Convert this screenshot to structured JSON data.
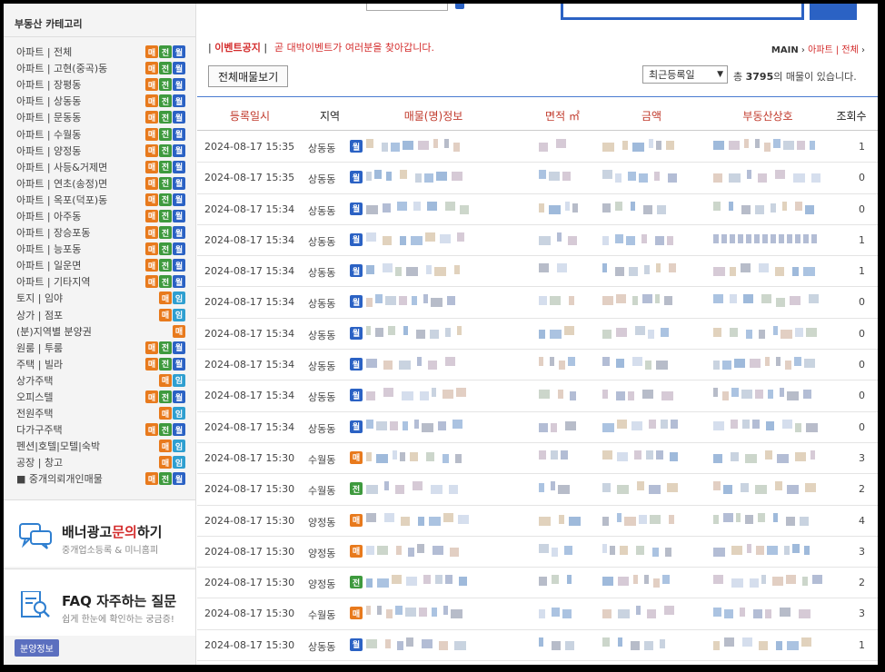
{
  "sidebar": {
    "title": "부동산 카테고리",
    "categories": [
      {
        "label": "아파트 | 전체",
        "badges": [
          "매",
          "전",
          "월"
        ]
      },
      {
        "label": "아파트 | 고현(중곡)동",
        "badges": [
          "매",
          "전",
          "월"
        ]
      },
      {
        "label": "아파트 | 장평동",
        "badges": [
          "매",
          "전",
          "월"
        ]
      },
      {
        "label": "아파트 | 상동동",
        "badges": [
          "매",
          "전",
          "월"
        ]
      },
      {
        "label": "아파트 | 문동동",
        "badges": [
          "매",
          "전",
          "월"
        ]
      },
      {
        "label": "아파트 | 수월동",
        "badges": [
          "매",
          "전",
          "월"
        ]
      },
      {
        "label": "아파트 | 양정동",
        "badges": [
          "매",
          "전",
          "월"
        ]
      },
      {
        "label": "아파트 | 사등&거제면",
        "badges": [
          "매",
          "전",
          "월"
        ]
      },
      {
        "label": "아파트 | 연초(송정)면",
        "badges": [
          "매",
          "전",
          "월"
        ]
      },
      {
        "label": "아파트 | 옥포(덕포)동",
        "badges": [
          "매",
          "전",
          "월"
        ]
      },
      {
        "label": "아파트 | 아주동",
        "badges": [
          "매",
          "전",
          "월"
        ]
      },
      {
        "label": "아파트 | 장승포동",
        "badges": [
          "매",
          "전",
          "월"
        ]
      },
      {
        "label": "아파트 | 능포동",
        "badges": [
          "매",
          "전",
          "월"
        ]
      },
      {
        "label": "아파트 | 일운면",
        "badges": [
          "매",
          "전",
          "월"
        ]
      },
      {
        "label": "아파트 | 기타지역",
        "badges": [
          "매",
          "전",
          "월"
        ]
      },
      {
        "label": "토지 | 임야",
        "badges": [
          "매",
          "임"
        ]
      },
      {
        "label": "상가 | 점포",
        "badges": [
          "매",
          "임"
        ]
      },
      {
        "label": "(분)지역별 분양권",
        "badges": [
          "매"
        ]
      },
      {
        "label": "원룸 | 투룸",
        "badges": [
          "매",
          "전",
          "월"
        ]
      },
      {
        "label": "주택 | 빌라",
        "badges": [
          "매",
          "전",
          "월"
        ]
      },
      {
        "label": "상가주택",
        "badges": [
          "매",
          "임"
        ]
      },
      {
        "label": "오피스텔",
        "badges": [
          "매",
          "전",
          "월"
        ]
      },
      {
        "label": "전원주택",
        "badges": [
          "매",
          "임"
        ]
      },
      {
        "label": "다가구주택",
        "badges": [
          "매",
          "전",
          "월"
        ]
      },
      {
        "label": "펜션|호텔|모텔|숙박",
        "badges": [
          "매",
          "임"
        ]
      },
      {
        "label": "공장 | 창고",
        "badges": [
          "매",
          "임"
        ]
      },
      {
        "label": "■ 중개의뢰개인매물",
        "badges": [
          "매",
          "전",
          "월"
        ]
      }
    ],
    "banner_ad": {
      "title_pre": "배너광고",
      "title_hl": "문의",
      "title_post": "하기",
      "sub": "중개업소등록 & 미니홈피",
      "icon": "chat-bubbles-icon"
    },
    "faq": {
      "title": "FAQ 자주하는 질문",
      "sub": "쉽게 한눈에 확인하는 궁금증!",
      "icon": "document-search-icon"
    },
    "bunyang_tag": "분양정보"
  },
  "main": {
    "notice_label": "이벤트공지",
    "notice_text": "곧 대박이벤트가 여러분을 찾아갑니다.",
    "breadcrumb": {
      "main": "MAIN",
      "sep": "›",
      "current": "아파트 | 전체"
    },
    "all_button": "전체매물보기",
    "sort": {
      "selected": "최근등록일"
    },
    "count": {
      "pre": "총",
      "num": "3795",
      "post": "의 매물이 있습니다."
    },
    "columns": [
      "등록일시",
      "지역",
      "매물(명)정보",
      "면적 ㎡",
      "금액",
      "부동산상호",
      "조회수"
    ],
    "rows": [
      {
        "date": "2024-08-17 15:35",
        "area": "상동동",
        "type": "월",
        "views": "1"
      },
      {
        "date": "2024-08-17 15:35",
        "area": "상동동",
        "type": "월",
        "views": "0"
      },
      {
        "date": "2024-08-17 15:34",
        "area": "상동동",
        "type": "월",
        "views": "0"
      },
      {
        "date": "2024-08-17 15:34",
        "area": "상동동",
        "type": "월",
        "views": "1"
      },
      {
        "date": "2024-08-17 15:34",
        "area": "상동동",
        "type": "월",
        "views": "1"
      },
      {
        "date": "2024-08-17 15:34",
        "area": "상동동",
        "type": "월",
        "views": "0"
      },
      {
        "date": "2024-08-17 15:34",
        "area": "상동동",
        "type": "월",
        "views": "0"
      },
      {
        "date": "2024-08-17 15:34",
        "area": "상동동",
        "type": "월",
        "views": "0"
      },
      {
        "date": "2024-08-17 15:34",
        "area": "상동동",
        "type": "월",
        "views": "0"
      },
      {
        "date": "2024-08-17 15:34",
        "area": "상동동",
        "type": "월",
        "views": "0"
      },
      {
        "date": "2024-08-17 15:30",
        "area": "수월동",
        "type": "매",
        "views": "3"
      },
      {
        "date": "2024-08-17 15:30",
        "area": "수월동",
        "type": "전",
        "views": "2"
      },
      {
        "date": "2024-08-17 15:30",
        "area": "양정동",
        "type": "매",
        "views": "4"
      },
      {
        "date": "2024-08-17 15:30",
        "area": "양정동",
        "type": "매",
        "views": "3"
      },
      {
        "date": "2024-08-17 15:30",
        "area": "양정동",
        "type": "전",
        "views": "2"
      },
      {
        "date": "2024-08-17 15:30",
        "area": "수월동",
        "type": "매",
        "views": "3"
      },
      {
        "date": "2024-08-17 15:30",
        "area": "상동동",
        "type": "월",
        "views": "1"
      }
    ]
  },
  "colors": {
    "mae": "#e87a1d",
    "jeon": "#3e9a3e",
    "wol": "#2b62c4",
    "im": "#2f9fd0",
    "accent_red": "#d42d2d",
    "accent_blue": "#2b62c4"
  }
}
